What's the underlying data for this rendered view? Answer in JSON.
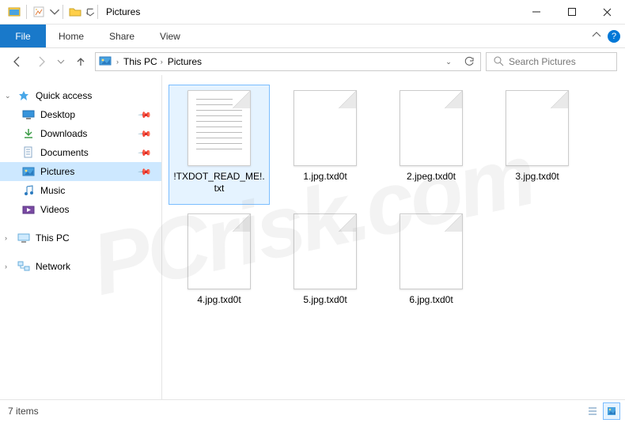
{
  "window": {
    "title": "Pictures"
  },
  "ribbon": {
    "file": "File",
    "tabs": [
      "Home",
      "Share",
      "View"
    ]
  },
  "breadcrumb": {
    "segments": [
      "This PC",
      "Pictures"
    ]
  },
  "search": {
    "placeholder": "Search Pictures"
  },
  "sidebar": {
    "quick_access": {
      "label": "Quick access",
      "items": [
        {
          "label": "Desktop",
          "icon": "desktop",
          "pinned": true
        },
        {
          "label": "Downloads",
          "icon": "downloads",
          "pinned": true
        },
        {
          "label": "Documents",
          "icon": "documents",
          "pinned": true
        },
        {
          "label": "Pictures",
          "icon": "pictures",
          "pinned": true,
          "selected": true
        },
        {
          "label": "Music",
          "icon": "music",
          "pinned": false
        },
        {
          "label": "Videos",
          "icon": "videos",
          "pinned": false
        }
      ]
    },
    "this_pc": {
      "label": "This PC"
    },
    "network": {
      "label": "Network"
    }
  },
  "files": [
    {
      "name": "!TXDOT_READ_ME!.txt",
      "type": "txt",
      "selected": true
    },
    {
      "name": "1.jpg.txd0t",
      "type": "blank"
    },
    {
      "name": "2.jpeg.txd0t",
      "type": "blank"
    },
    {
      "name": "3.jpg.txd0t",
      "type": "blank"
    },
    {
      "name": "4.jpg.txd0t",
      "type": "blank"
    },
    {
      "name": "5.jpg.txd0t",
      "type": "blank"
    },
    {
      "name": "6.jpg.txd0t",
      "type": "blank"
    }
  ],
  "status": {
    "text": "7 items"
  },
  "watermark": "PCrisk.com"
}
